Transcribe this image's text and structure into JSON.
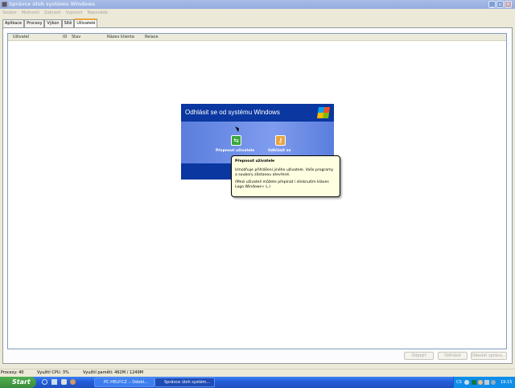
{
  "window": {
    "title": "Správce úloh systému Windows"
  },
  "menu": [
    "Soubor",
    "Možnosti",
    "Zobrazit",
    "Vypnout",
    "Nápověda"
  ],
  "tabs": [
    {
      "label": "Aplikace"
    },
    {
      "label": "Procesy"
    },
    {
      "label": "Výkon"
    },
    {
      "label": "Sítě"
    },
    {
      "label": "Uživatelé",
      "active": true
    }
  ],
  "columns": [
    "Uživatel",
    "ID",
    "Stav",
    "Název klienta",
    "Relace"
  ],
  "buttons": {
    "disconnect": "Odpojit",
    "logoff": "Odhlásit",
    "send_message": "Odeslat zprávu..."
  },
  "status": {
    "processes": "Procesy: 40",
    "cpu": "Využití CPU: 3%",
    "memory": "Využití paměti: 462M / 1249M"
  },
  "dialog": {
    "title": "Odhlásit se od systému Windows",
    "switch_user": "Přepnout uživatele",
    "logoff": "Odhlásit se"
  },
  "tooltip": {
    "title": "Přepnout uživatele",
    "line1": "Umožňuje přihlášení jiného uživatele. Vaše programy a soubory zůstanou otevřené.",
    "line2": "(Mezi uživateli můžete přepínat i stisknutím kláves Logo Windows+ L.)"
  },
  "taskbar": {
    "start": "Start",
    "tasks": [
      {
        "label": "PC-HELP.CZ :: Odebí..."
      },
      {
        "label": "Správce úloh systém...",
        "active": true
      }
    ],
    "clock": "19:15",
    "lang": "CS"
  },
  "colors": {
    "taskbar": "#245edb",
    "dialog_header": "#0a37a0",
    "tooltip_bg": "#ffffe1"
  }
}
